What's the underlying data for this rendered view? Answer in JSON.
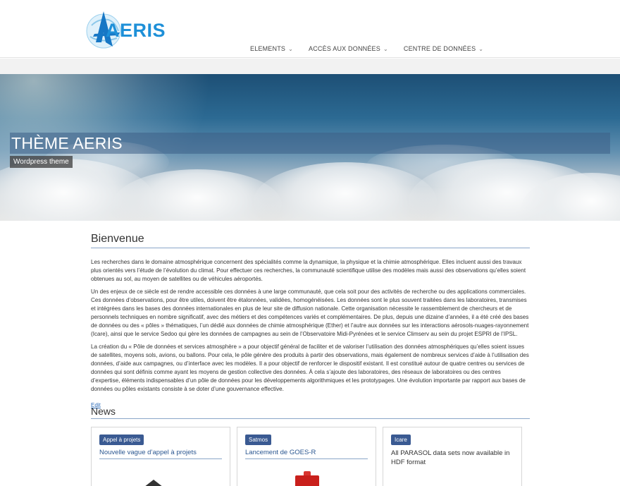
{
  "header": {
    "logo_text": "AERIS",
    "nav": [
      {
        "label": "ELEMENTS"
      },
      {
        "label": "ACCÈS AUX DONNÉES"
      },
      {
        "label": "CENTRE DE DONNÉES"
      }
    ]
  },
  "hero": {
    "title": "THÈME AERIS",
    "subtitle": "Wordpress theme"
  },
  "main": {
    "heading": "Bienvenue",
    "paragraphs": [
      "Les recherches dans le domaine atmosphérique concernent des spécialités comme la dynamique, la physique et la chimie atmosphérique. Elles incluent aussi des travaux plus orientés vers l’étude de l’évolution du climat. Pour effectuer ces recherches, la communauté scientifique utilise des modèles mais aussi des observations qu’elles soient obtenues au sol, au moyen de satellites ou de véhicules aéroportés.",
      "Un des enjeux de ce siècle est de rendre accessible ces données à une large communauté, que cela soit pour des activités de recherche ou des applications commerciales. Ces données d’observations, pour être utiles, doivent être étalonnées, validées, homogénéisées. Les données sont le plus souvent traitées dans les laboratoires, transmises et intégrées dans les bases des données internationales en plus de leur site de diffusion nationale. Cette organisation nécessite le rassemblement de chercheurs et de personnels techniques en nombre significatif, avec des métiers et des compétences variés et complémentaires. De plus, depuis une dizaine d’années, il a été créé des bases de données ou des « pôles » thématiques, l’un dédié aux données de chimie atmosphérique (Ether) et l’autre aux données sur les interactions aérosols-nuages-rayonnement (Icare), ainsi que le service Sedoo qui gère les données de campagnes au sein de l’Observatoire Midi-Pyrénées et le service Climserv au sein du projet ESPRI de l’IPSL.",
      "La création du « Pôle de données et services atmosphère » a pour objectif général de faciliter et de valoriser l’utilisation des données atmosphériques qu’elles soient issues de satellites, moyens sols, avions, ou ballons. Pour cela, le pôle génère des produits à partir des observations, mais également de nombreux services d’aide à l’utilisation des données, d’aide aux campagnes, ou d’interface avec les modèles. Il a pour objectif de renforcer le dispositif existant. Il est constitué autour de quatre centres ou services de données qui sont définis comme ayant les moyens de gestion collective des données. À cela s’ajoute des laboratoires, des réseaux de laboratoires ou des centres d’expertise, éléments indispensables d’un pôle de données pour les développements algorithmiques et les prototypages. Une évolution importante par rapport aux bases de données ou pôles existants consiste à se doter d’une gouvernance effective."
    ],
    "edit_label": "Edit"
  },
  "news": {
    "heading": "News",
    "cards": [
      {
        "badge": "Appel à projets",
        "title": "Nouvelle vague d’appel à projets"
      },
      {
        "badge": "Satmos",
        "title": "Lancement de GOES-R"
      },
      {
        "badge": "Icare",
        "title": "All PARASOL data sets now available in HDF format"
      }
    ]
  },
  "colors": {
    "accent": "#1e90d8",
    "badge": "#3a5a92",
    "link": "#2a6ab8"
  }
}
